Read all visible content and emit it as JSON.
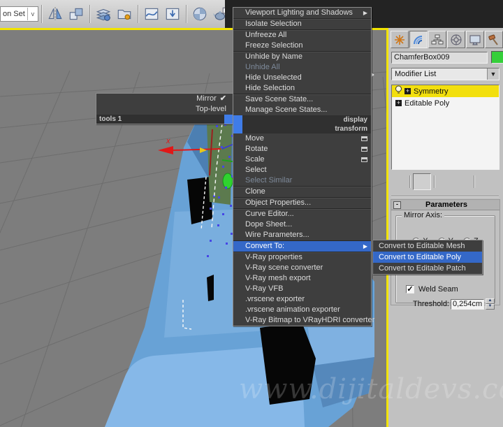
{
  "toolbar": {
    "selection_set_value": "on Set",
    "icons": [
      "mirror-icon",
      "align-icon",
      "layer-manager-icon",
      "scene-explorer-icon",
      "curve-editor-icon",
      "schematic-view-icon",
      "material-editor-icon",
      "render-setup-icon",
      "rendered-frame-icon"
    ]
  },
  "quad_menu": {
    "left_header": "tools 1",
    "left_items": [
      {
        "label": "Mirror",
        "checked": true
      },
      {
        "label": "Top-level",
        "checked": false
      }
    ],
    "headers": {
      "display": "display",
      "transform": "transform"
    },
    "display_items": [
      {
        "label": "Viewport Lighting and Shadows",
        "submenu": true,
        "sep": true
      },
      {
        "label": "Isolate Selection",
        "sep": true
      },
      {
        "label": "Unfreeze All"
      },
      {
        "label": "Freeze Selection",
        "sep": true
      },
      {
        "label": "Unhide by Name"
      },
      {
        "label": "Unhide All",
        "disabled": true
      },
      {
        "label": "Hide Unselected"
      },
      {
        "label": "Hide Selection",
        "sep": true
      },
      {
        "label": "Save Scene State..."
      },
      {
        "label": "Manage Scene States..."
      }
    ],
    "transform_items": [
      {
        "label": "Move",
        "settings": true
      },
      {
        "label": "Rotate",
        "settings": true
      },
      {
        "label": "Scale",
        "settings": true
      },
      {
        "label": "Select"
      },
      {
        "label": "Select Similar",
        "disabled": true,
        "sep": true
      },
      {
        "label": "Clone",
        "sep": true
      },
      {
        "label": "Object Properties...",
        "sep": true
      },
      {
        "label": "Curve Editor..."
      },
      {
        "label": "Dope Sheet..."
      },
      {
        "label": "Wire Parameters...",
        "sep": true
      },
      {
        "label": "Convert To:",
        "submenu": true,
        "highlighted": true,
        "sep": true
      },
      {
        "label": "V-Ray properties"
      },
      {
        "label": "V-Ray scene converter"
      },
      {
        "label": "V-Ray mesh export"
      },
      {
        "label": "V-Ray VFB"
      },
      {
        "label": ".vrscene exporter"
      },
      {
        "label": ".vrscene animation exporter"
      },
      {
        "label": "V-Ray Bitmap to VRayHDRI converter"
      }
    ]
  },
  "submenu": {
    "items": [
      {
        "label": "Convert to Editable Mesh"
      },
      {
        "label": "Convert to Editable Poly",
        "highlighted": true
      },
      {
        "label": "Convert to Editable Patch"
      }
    ]
  },
  "command_panel": {
    "tabs": [
      "create-tab",
      "modify-tab",
      "hierarchy-tab",
      "motion-tab",
      "display-tab",
      "utilities-tab"
    ],
    "active_tab": "modify-tab",
    "object_name": "ChamferBox009",
    "modifier_list_label": "Modifier List",
    "modifier_stack": [
      {
        "label": "Symmetry",
        "selected": true,
        "bulb": true
      },
      {
        "label": "Editable Poly",
        "selected": false,
        "bulb": false
      }
    ],
    "stack_tools": [
      "pin-stack",
      "show-end-result",
      "make-unique",
      "remove-modifier",
      "configure-modifier-sets"
    ],
    "parameters": {
      "title": "Parameters",
      "mirror_axis_label": "Mirror Axis:",
      "axes": [
        "X",
        "Y",
        "Z"
      ],
      "selected_axis": "Z",
      "weld_seam_label": "Weld Seam",
      "weld_seam_checked": true,
      "threshold_label": "Threshold:",
      "threshold_value": "0,254cm"
    }
  },
  "viewport": {
    "axis_label": "x",
    "watermark": "www.dijitaldevs.com"
  },
  "colors": {
    "menu_highlight": "#3468c8",
    "stack_selected_yellow": "#f2df0e",
    "viewport_border_yellow": "#f2e400",
    "object_blue": "#68a2d6",
    "swatch_green": "#35cf3a",
    "menu_bg": "#3e3e3e"
  }
}
